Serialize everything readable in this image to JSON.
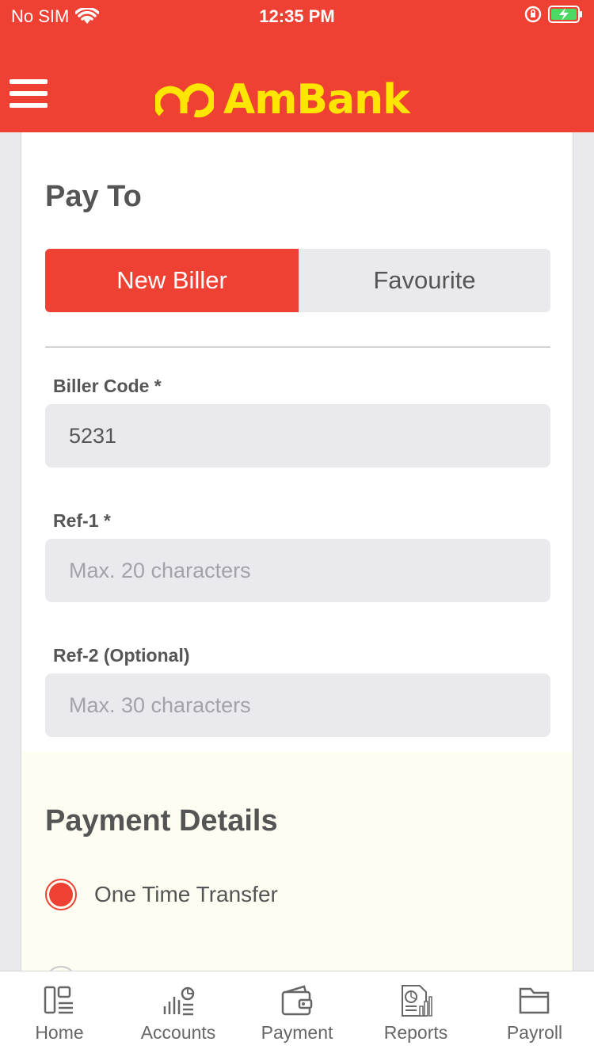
{
  "status": {
    "carrier": "No SIM",
    "time": "12:35 PM"
  },
  "header": {
    "brand": "AmBank"
  },
  "pay_to": {
    "title": "Pay To",
    "tabs": [
      "New Biller",
      "Favourite"
    ],
    "active_tab": "New Biller"
  },
  "fields": {
    "biller_code": {
      "label": "Biller Code *",
      "value": "5231"
    },
    "ref1": {
      "label": "Ref-1 *",
      "placeholder": "Max. 20 characters"
    },
    "ref2": {
      "label": "Ref-2 (Optional)",
      "placeholder": "Max. 30 characters"
    }
  },
  "payment_details": {
    "title": "Payment Details",
    "option_selected": "One Time Transfer"
  },
  "tabbar": [
    {
      "label": "Home",
      "icon": "home-icon"
    },
    {
      "label": "Accounts",
      "icon": "accounts-icon"
    },
    {
      "label": "Payment",
      "icon": "wallet-icon"
    },
    {
      "label": "Reports",
      "icon": "reports-icon"
    },
    {
      "label": "Payroll",
      "icon": "folder-icon"
    }
  ],
  "colors": {
    "brand_red": "#ef4133",
    "logo_yellow": "#ffe600"
  }
}
